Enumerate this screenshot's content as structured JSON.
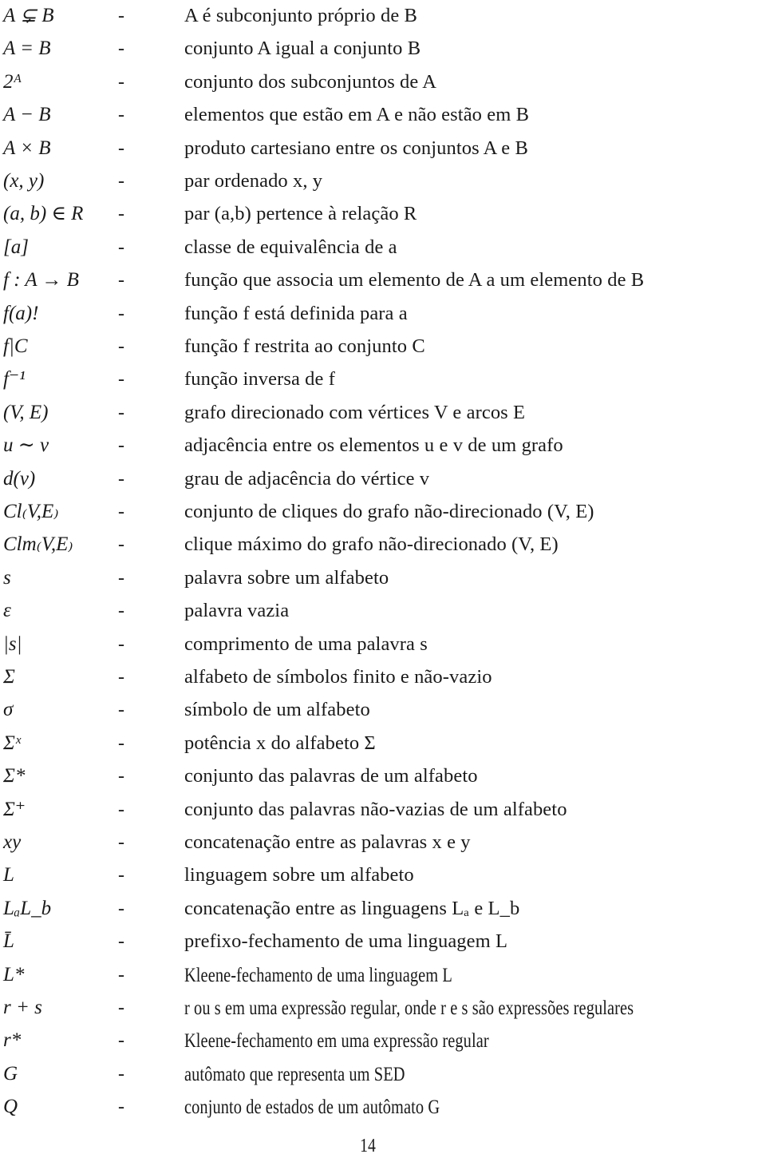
{
  "notation_list": {
    "separator": "-",
    "entries": [
      {
        "symbol": "A ⊊ B",
        "description": "A é subconjunto próprio de B"
      },
      {
        "symbol": "A = B",
        "description": "conjunto A igual a conjunto B"
      },
      {
        "symbol": "2ᴬ",
        "description": "conjunto dos subconjuntos de A"
      },
      {
        "symbol": "A − B",
        "description": "elementos que estão em A e não estão em B"
      },
      {
        "symbol": "A × B",
        "description": "produto cartesiano entre os conjuntos A e B"
      },
      {
        "symbol": "(x, y)",
        "description": "par ordenado x, y"
      },
      {
        "symbol": "(a, b) ∈ R",
        "description": "par (a,b) pertence à relação R"
      },
      {
        "symbol": "[a]",
        "description": "classe de equivalência de a"
      },
      {
        "symbol": "f : A → B",
        "description": "função que associa um elemento de A a um elemento de B"
      },
      {
        "symbol": "f(a)!",
        "description": "função f está definida para a"
      },
      {
        "symbol": "f|C",
        "description": "função f restrita ao conjunto C"
      },
      {
        "symbol": "f⁻¹",
        "description": "função inversa de f"
      },
      {
        "symbol": "(V, E)",
        "description": "grafo direcionado com vértices V e arcos E"
      },
      {
        "symbol": "u ∼ v",
        "description": "adjacência entre os elementos u e v de um grafo"
      },
      {
        "symbol": "d(v)",
        "description": "grau de adjacência do vértice v"
      },
      {
        "symbol": "Cl₍V,E₎",
        "description": "conjunto de cliques do grafo não-direcionado (V, E)"
      },
      {
        "symbol": "Clm₍V,E₎",
        "description": "clique máximo do grafo não-direcionado (V, E)"
      },
      {
        "symbol": "s",
        "description": "palavra sobre um alfabeto"
      },
      {
        "symbol": "ε",
        "description": "palavra vazia"
      },
      {
        "symbol": "|s|",
        "description": "comprimento de uma palavra s"
      },
      {
        "symbol": "Σ",
        "description": "alfabeto de símbolos finito e não-vazio"
      },
      {
        "symbol": "σ",
        "description": "símbolo de um alfabeto"
      },
      {
        "symbol": "Σˣ",
        "description": "potência x do alfabeto Σ"
      },
      {
        "symbol": "Σ*",
        "description": "conjunto das palavras de um alfabeto"
      },
      {
        "symbol": "Σ⁺",
        "description": "conjunto das palavras não-vazias de um alfabeto"
      },
      {
        "symbol": "xy",
        "description": "concatenação entre as palavras x e y"
      },
      {
        "symbol": "L",
        "description": "linguagem sobre um alfabeto"
      },
      {
        "symbol": "LₐL_b",
        "description": "concatenação entre as linguagens Lₐ e L_b"
      },
      {
        "symbol": "L̄",
        "description": "prefixo-fechamento de uma linguagem L"
      },
      {
        "symbol": "L*",
        "description": "Kleene-fechamento de uma linguagem L"
      },
      {
        "symbol": "r + s",
        "description": "r ou s em uma expressão regular, onde r e s são expressões regulares"
      },
      {
        "symbol": "r*",
        "description": "Kleene-fechamento em uma expressão regular"
      },
      {
        "symbol": "G",
        "description": "autômato que representa um SED"
      },
      {
        "symbol": "Q",
        "description": "conjunto de estados de um autômato G"
      }
    ]
  },
  "footer": {
    "page_number": "14"
  }
}
